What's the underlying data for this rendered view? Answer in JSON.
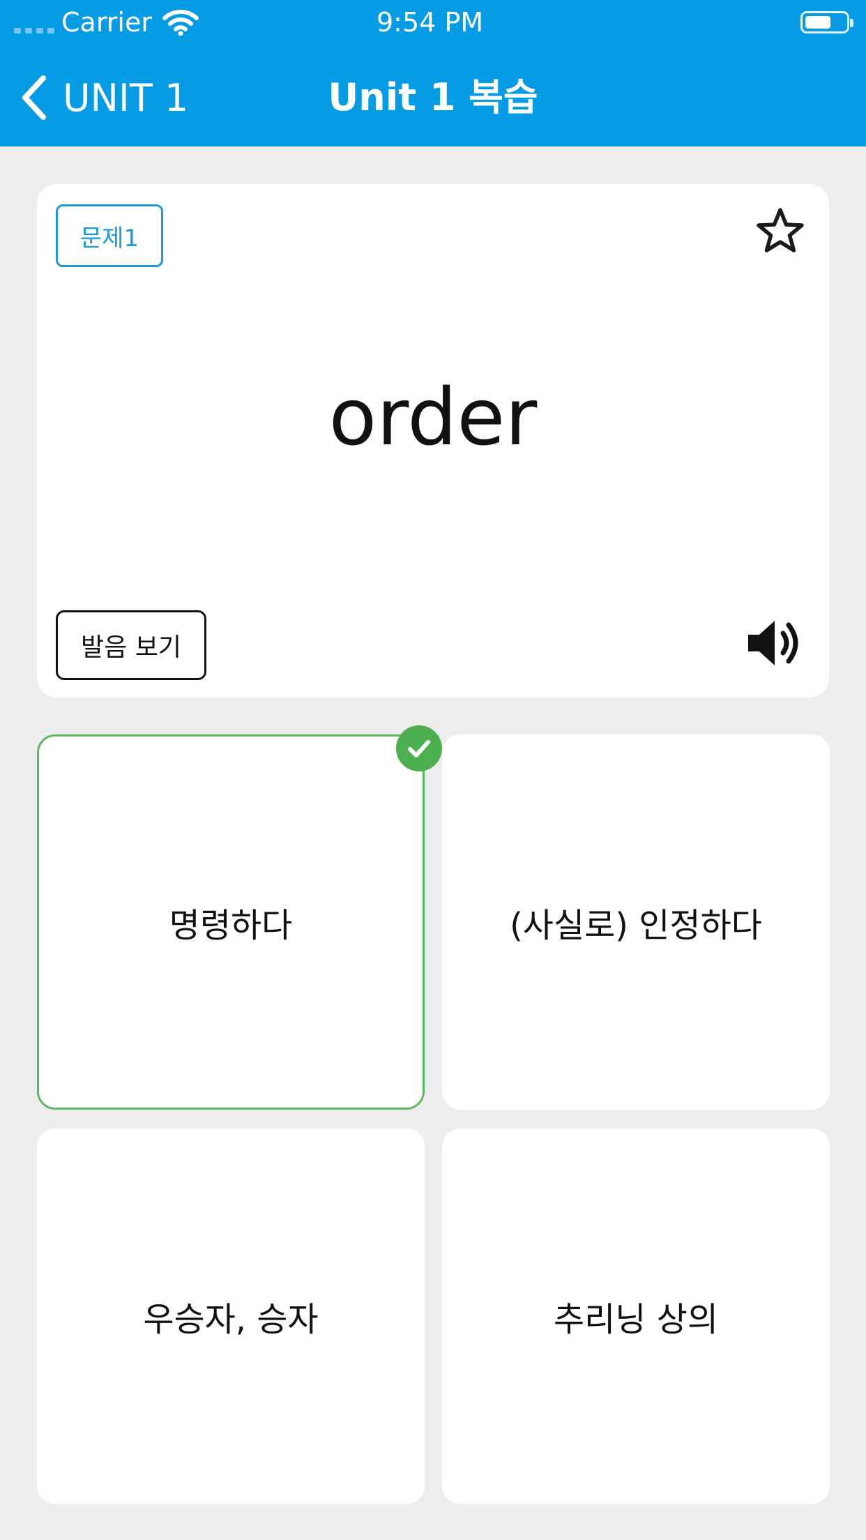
{
  "status_bar": {
    "carrier": "Carrier",
    "time": "9:54 PM",
    "icons": [
      "signal-icon",
      "wifi-icon",
      "battery-icon"
    ]
  },
  "nav": {
    "back_label": "UNIT 1",
    "title": "Unit 1 복습"
  },
  "question": {
    "badge": "문제1",
    "word": "order",
    "pronunciation_button": "발음 보기",
    "icons": [
      "star-icon",
      "speaker-icon"
    ]
  },
  "choices": [
    {
      "label": "명령하다",
      "correct": true
    },
    {
      "label": "(사실로) 인정하다",
      "correct": false
    },
    {
      "label": "우승자, 승자",
      "correct": false
    },
    {
      "label": "추리닝 상의",
      "correct": false
    }
  ],
  "colors": {
    "header_bg": "#059be5",
    "page_bg": "#ededed",
    "badge_blue": "#1a9ad8",
    "correct_green": "#4caf50"
  }
}
